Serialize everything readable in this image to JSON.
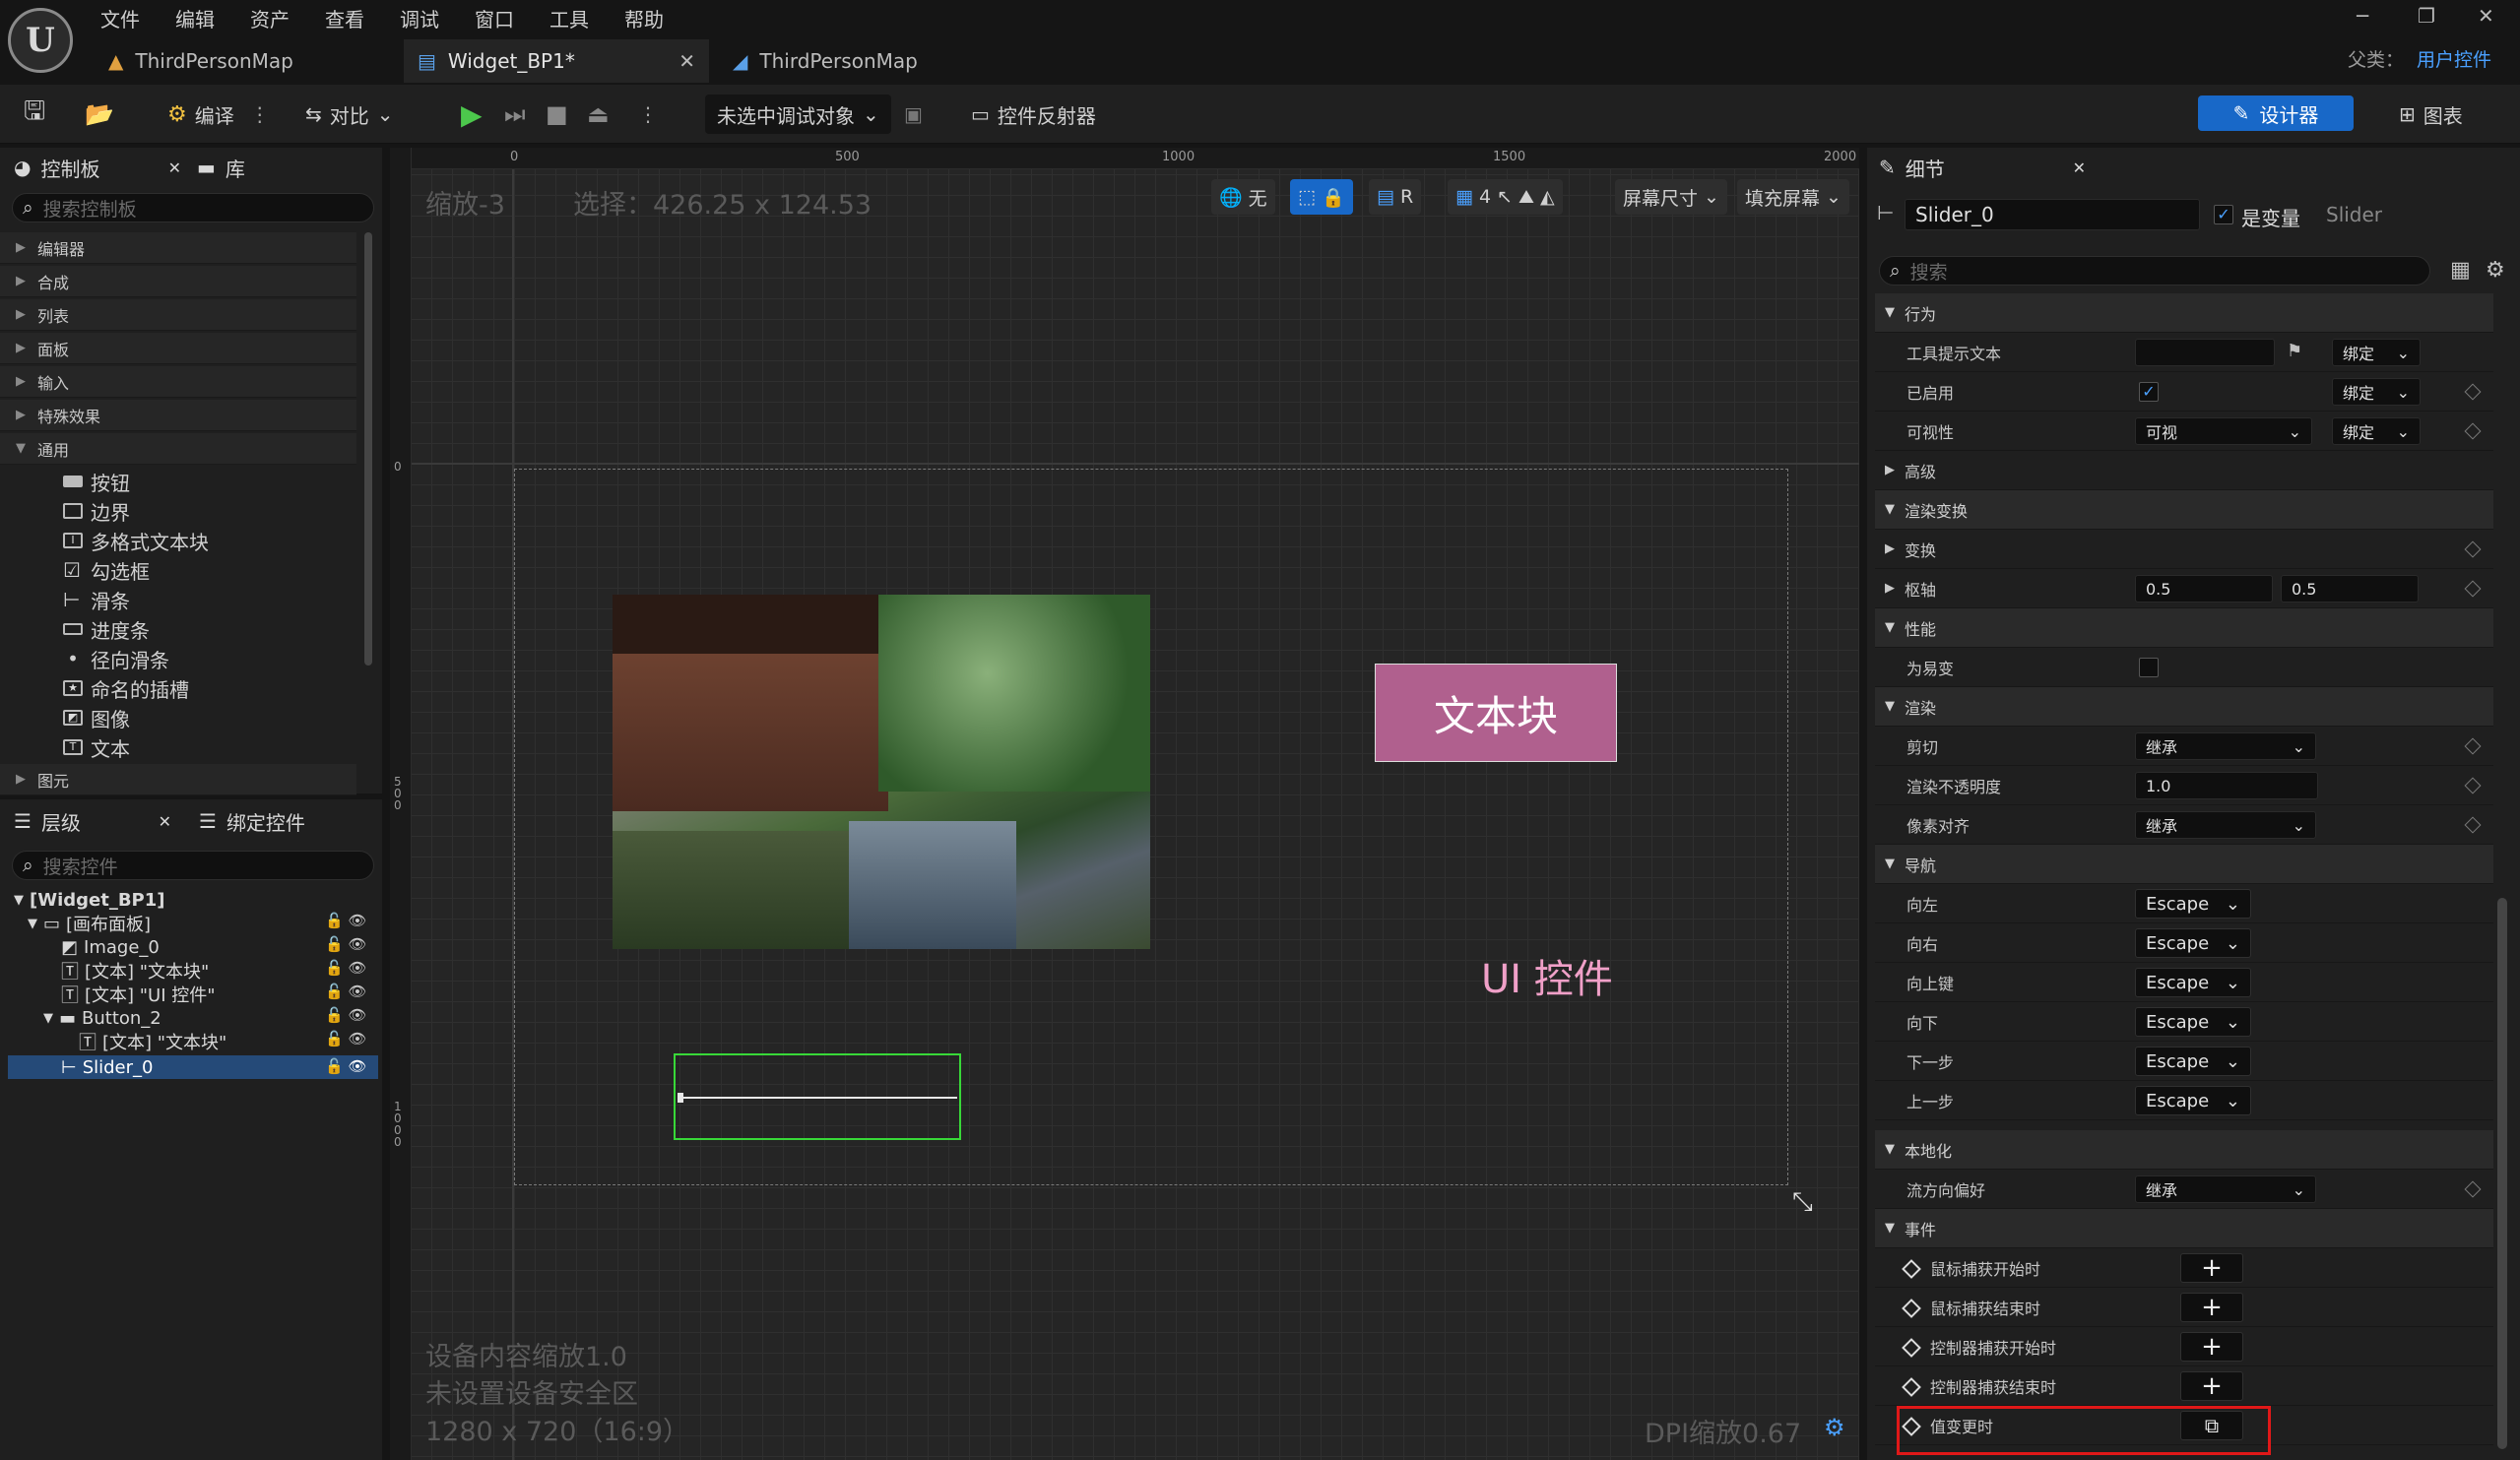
{
  "menu": [
    "文件",
    "编辑",
    "资产",
    "查看",
    "调试",
    "窗口",
    "工具",
    "帮助"
  ],
  "tabs": [
    {
      "label": "ThirdPersonMap"
    },
    {
      "label": "Widget_BP1*"
    },
    {
      "label": "ThirdPersonMap"
    }
  ],
  "parent": {
    "label": "父类：",
    "value": "用户控件"
  },
  "toolbar": {
    "compile": "编译",
    "diff": "对比",
    "debug_target": "未选中调试对象",
    "reflector": "控件反射器",
    "designer": "设计器",
    "graph": "图表"
  },
  "palette": {
    "tab_label": "控制板",
    "library_label": "库",
    "search_placeholder": "搜索控制板",
    "categories": [
      "编辑器",
      "合成",
      "列表",
      "面板",
      "输入",
      "特殊效果",
      "通用"
    ],
    "items": [
      "按钮",
      "边界",
      "多格式文本块",
      "勾选框",
      "滑条",
      "进度条",
      "径向滑条",
      "命名的插槽",
      "图像",
      "文本"
    ],
    "last_category": "图元"
  },
  "hierarchy": {
    "tab_label": "层级",
    "bind_label": "绑定控件",
    "search_placeholder": "搜索控件",
    "rows": [
      "[Widget_BP1]",
      "[画布面板]",
      "Image_0",
      "[文本] \"文本块\"",
      "[文本] \"UI 控件\"",
      "Button_2",
      "[文本] \"文本块\"",
      "Slider_0"
    ]
  },
  "canvas": {
    "zoom": "缩放-3",
    "selection": "选择：426.25 x 124.53",
    "ruler_top": [
      "0",
      "500",
      "1000",
      "1500",
      "2000"
    ],
    "ruler_left": [
      "0",
      "500",
      "1000"
    ],
    "tools": {
      "none": "无",
      "r": "R",
      "grid": "4",
      "screen_size": "屏幕尺寸",
      "fill_screen": "填充屏幕"
    },
    "button_text": "文本块",
    "ui_text": "UI 控件",
    "device_scale": "设备内容缩放1.0",
    "safe_zone": "未设置设备安全区",
    "resolution": "1280 x 720（16:9）",
    "dpi": "DPI缩放0.67",
    "button_color": "#b0608e",
    "ui_text_color": "#f0a0c8"
  },
  "details": {
    "tab_label": "细节",
    "name": "Slider_0",
    "is_variable": "是变量",
    "type": "Slider",
    "search_placeholder": "搜索",
    "sec_behavior": "行为",
    "tooltip": "工具提示文本",
    "bind": "绑定",
    "enabled": "已启用",
    "visibility": "可视性",
    "visible": "可视",
    "advanced": "高级",
    "sec_render_transform": "渲染变换",
    "transform": "变换",
    "pivot": "枢轴",
    "pivot_x": "0.5",
    "pivot_y": "0.5",
    "sec_perf": "性能",
    "volatile": "为易变",
    "sec_render": "渲染",
    "clipping": "剪切",
    "inherit": "继承",
    "opacity_label": "渲染不透明度",
    "opacity": "1.0",
    "pixel_snap": "像素对齐",
    "sec_nav": "导航",
    "nav": [
      "向左",
      "向右",
      "向上键",
      "向下",
      "下一步",
      "上一步"
    ],
    "escape": "Escape",
    "sec_local": "本地化",
    "flow_dir": "流方向偏好",
    "sec_events": "事件",
    "events": [
      "鼠标捕获开始时",
      "鼠标捕获结束时",
      "控制器捕获开始时",
      "控制器捕获结束时",
      "值变更时"
    ],
    "highlight_color": "#e01818"
  }
}
